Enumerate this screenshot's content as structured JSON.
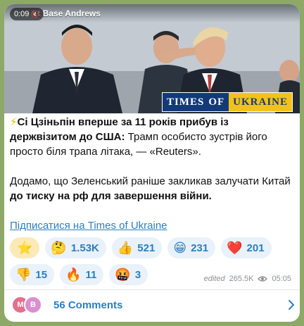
{
  "media": {
    "duration": "0:09",
    "banner": "nt Base Andrews",
    "watermark_a": "TIMES",
    "watermark_of": "OF",
    "watermark_b": "UKRAINE"
  },
  "post": {
    "headline_icon": "⚡",
    "headline_bold": "Сі Цзіньпін вперше за 11 років прибув із держвізитом до США:",
    "headline_rest": " Трамп особисто зустрів його просто біля трапа літака, — «Reuters».",
    "p2_pre": "Додамо, що Зеленський раніше закликав залучати Китай ",
    "p2_bold": "до тиску на рф для завершення війни.",
    "subscribe_link": "Підписатися на Times of Ukraine"
  },
  "reactions": [
    {
      "emoji": "⭐",
      "count": ""
    },
    {
      "emoji": "🤔",
      "count": "1.53K"
    },
    {
      "emoji": "👍",
      "count": "521"
    },
    {
      "emoji": "😁",
      "count": "231"
    },
    {
      "emoji": "❤️",
      "count": "201"
    },
    {
      "emoji": "👎",
      "count": "15"
    },
    {
      "emoji": "🔥",
      "count": "11"
    },
    {
      "emoji": "🤬",
      "count": "3"
    }
  ],
  "meta": {
    "edited": "edited",
    "views": "265.5K",
    "time": "05:05",
    "eye_icon": "eye-icon"
  },
  "comments": {
    "avatars": [
      {
        "initial": "M",
        "color": "#e56f8c"
      },
      {
        "initial": "B",
        "color": "#d98fd0"
      }
    ],
    "label": "56 Comments"
  },
  "colors": {
    "background": "#8ea867",
    "accent": "#2a7fc0",
    "chip_bg": "#e9f1fa"
  }
}
